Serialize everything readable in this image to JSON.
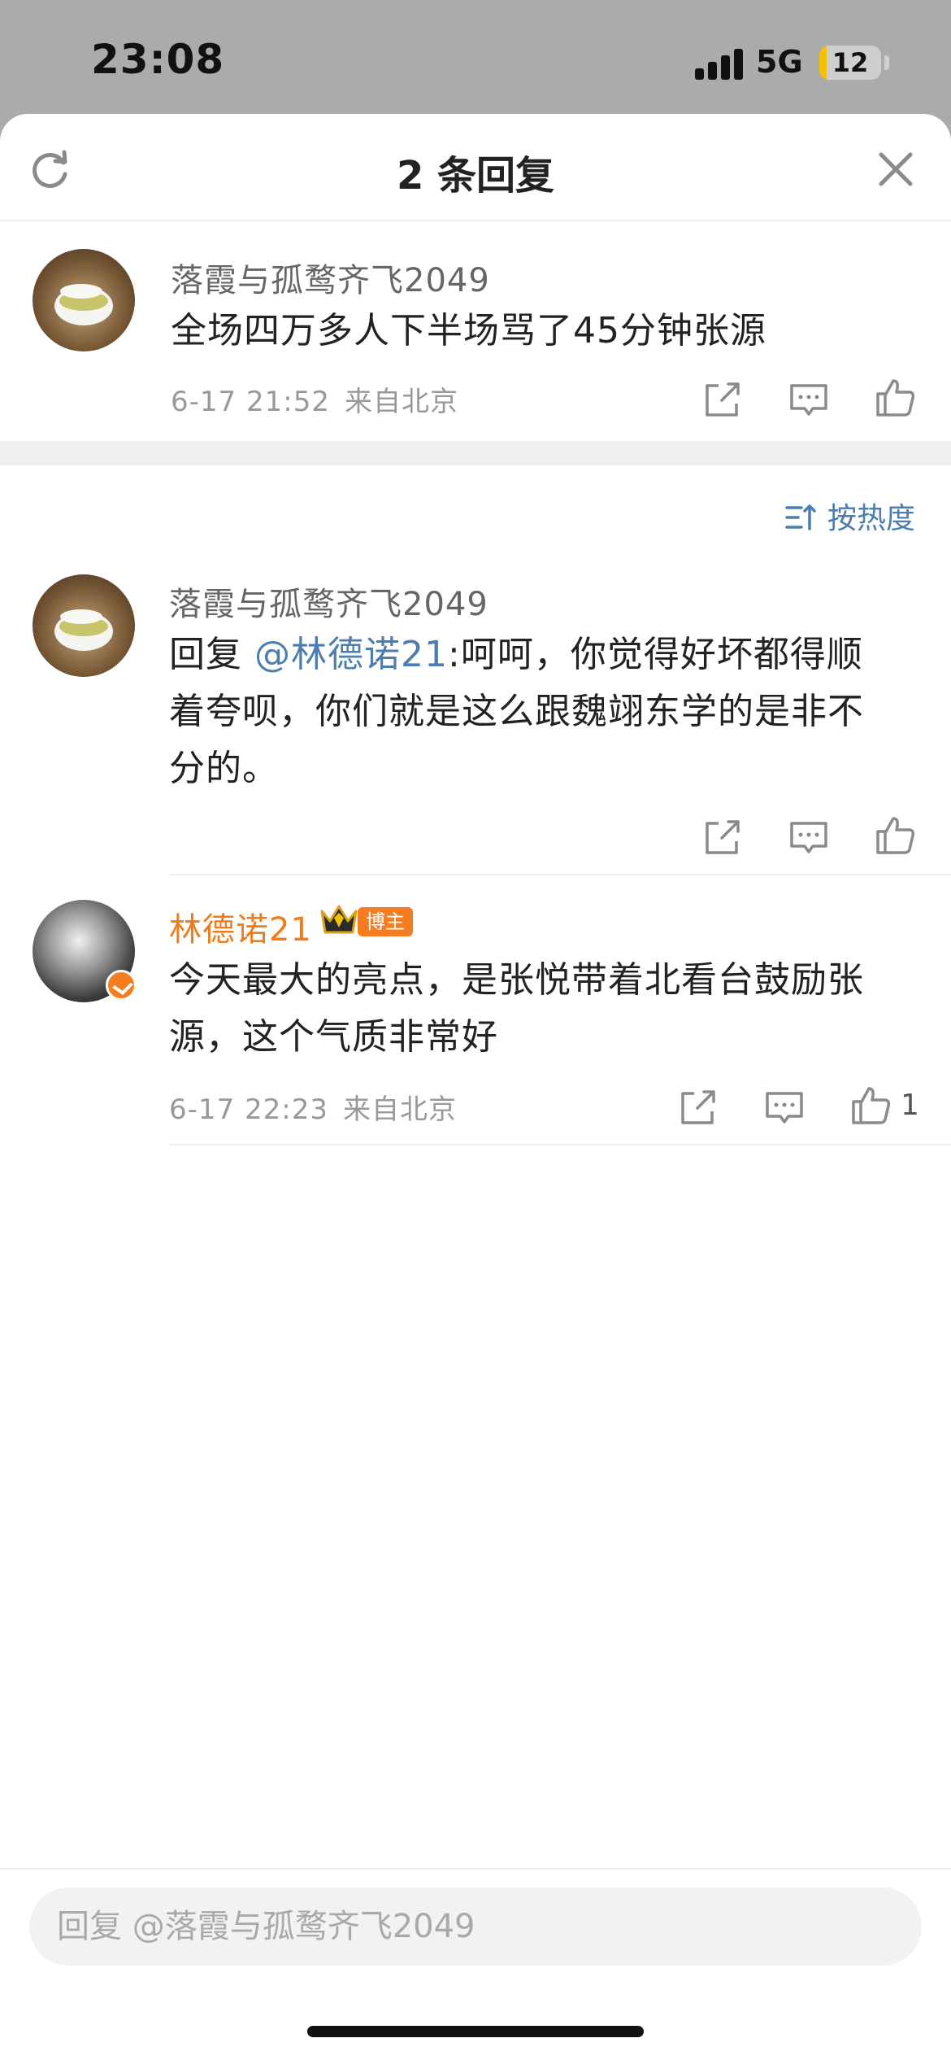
{
  "status_bar": {
    "time": "23:08",
    "network": "5G",
    "battery": "12"
  },
  "header": {
    "title": "2 条回复",
    "refresh_icon": "refresh-icon",
    "close_icon": "close-icon"
  },
  "root_comment": {
    "username": "落霞与孤鹜齐飞2049",
    "text": "全场四万多人下半场骂了45分钟张源",
    "date": "6-17 21:52",
    "location": "来自北京"
  },
  "sort": {
    "label": "按热度",
    "icon": "sort-icon"
  },
  "replies": [
    {
      "username": "落霞与孤鹜齐飞2049",
      "reply_prefix": "回复 ",
      "mention": "@林德诺21",
      "text_line1": ":呵呵，你觉得好坏都得顺",
      "text_line2": "着夸呗，你们就是这么跟魏翊东学的是非不",
      "text_line3": "分的。"
    },
    {
      "username": "林德诺21",
      "badge": "博主",
      "text_line1": "今天最大的亮点，是张悦带着北看台鼓励张",
      "text_line2": "源，这个气质非常好",
      "date": "6-17 22:23",
      "location": "来自北京",
      "like_count": "1"
    }
  ],
  "input": {
    "placeholder": "回复 @落霞与孤鹜齐飞2049"
  },
  "colors": {
    "accent": "#4d7cae",
    "orange": "#f07b18",
    "text": "#222222",
    "meta": "#999999"
  }
}
